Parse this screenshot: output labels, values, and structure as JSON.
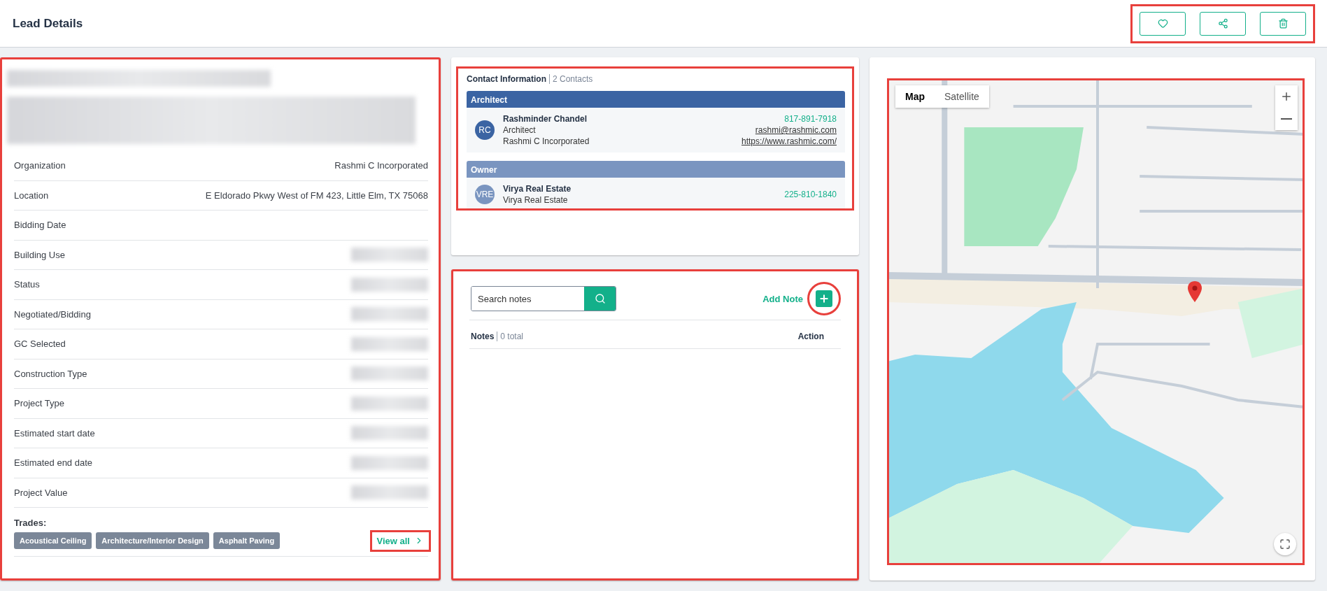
{
  "header": {
    "title": "Lead Details",
    "highlighted": true,
    "actions": [
      {
        "kind": "favorite"
      },
      {
        "kind": "share"
      },
      {
        "kind": "delete"
      }
    ]
  },
  "lead": {
    "highlighted": true,
    "fields": [
      {
        "label": "Organization",
        "value": "Rashmi C Incorporated"
      },
      {
        "label": "Location",
        "value": "E Eldorado Pkwy West of FM 423, Little Elm, TX 75068"
      },
      {
        "label": "Bidding Date"
      },
      {
        "label": "Building Use",
        "redacted": true
      },
      {
        "label": "Status",
        "redacted": true
      },
      {
        "label": "Negotiated/Bidding",
        "redacted": true
      },
      {
        "label": "GC Selected",
        "redacted": true
      },
      {
        "label": "Construction Type",
        "redacted": true
      },
      {
        "label": "Project Type",
        "redacted": true
      },
      {
        "label": "Estimated start date",
        "redacted": true
      },
      {
        "label": "Estimated end date",
        "redacted": true
      },
      {
        "label": "Project Value",
        "redacted": true
      }
    ],
    "trades_label": "Trades:",
    "trades": [
      "Acoustical Ceiling",
      "Architecture/Interior Design",
      "Asphalt Paving"
    ],
    "view_all": {
      "label": "View all",
      "highlighted": true
    }
  },
  "contacts": {
    "title": "Contact Information",
    "count": "2 Contacts",
    "highlighted": true,
    "groups": [
      {
        "role": "Architect",
        "color": "#3b64a3",
        "initials": "RC",
        "name": "Rashminder Chandel",
        "lines": [
          "Architect",
          "Rashmi C Incorporated"
        ],
        "phone": "817-891-7918",
        "email": "rashmi@rashmic.com",
        "website": "https://www.rashmic.com/"
      },
      {
        "role": "Owner",
        "color": "#7a95c0",
        "initials": "VRE",
        "name": "Virya Real Estate",
        "lines": [
          "Virya Real Estate"
        ],
        "phone": "225-810-1840"
      }
    ]
  },
  "notes": {
    "highlighted": true,
    "search": {
      "placeholder": "Search notes"
    },
    "add_label": "Add Note",
    "add_highlighted": true,
    "title": "Notes",
    "count": "0 total",
    "action_label": "Action"
  },
  "map": {
    "highlighted": true,
    "tabs": [
      {
        "label": "Map",
        "selected": true
      },
      {
        "label": "Satellite",
        "selected": false
      }
    ]
  }
}
